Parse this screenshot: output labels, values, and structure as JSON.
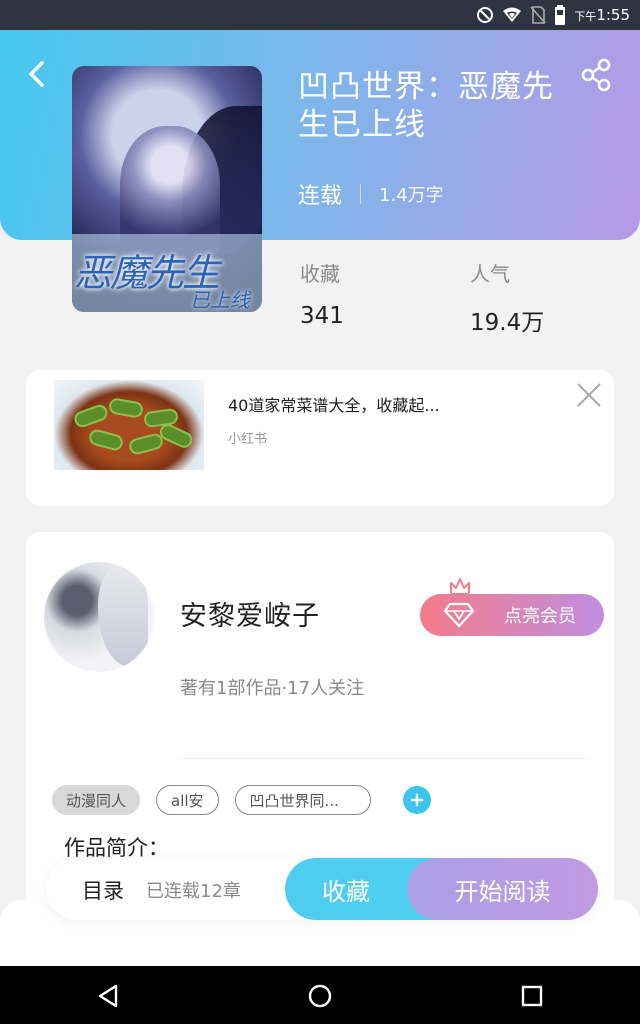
{
  "status_bar": {
    "time_prefix": "下午",
    "time": "1:55",
    "icons": [
      "dnd-icon",
      "wifi-icon",
      "no-sim-icon",
      "battery-icon"
    ]
  },
  "book": {
    "title": "凹凸世界：恶魔先生已上线",
    "serial_status": "连载",
    "word_count": "1.4万字",
    "cover_text_main": "恶魔先生",
    "cover_text_sub": "已上线",
    "stats": [
      {
        "label": "收藏",
        "value": "341"
      },
      {
        "label": "人气",
        "value": "19.4万"
      }
    ]
  },
  "ad": {
    "title": "40道家常菜谱大全，收藏起...",
    "source": "小红书"
  },
  "author": {
    "name": "安黎爱峖子",
    "meta": "著有1部作品·17人关注",
    "vip_label": "点亮会员"
  },
  "tags": [
    {
      "label": "动漫同人",
      "style": "filled"
    },
    {
      "label": "all安",
      "style": "outline"
    },
    {
      "label": "凹凸世界同...",
      "style": "outline"
    }
  ],
  "intro_label": "作品简介：",
  "action_bar": {
    "toc_label": "目录",
    "chapters": "已连载12章",
    "favorite_label": "收藏",
    "read_label": "开始阅读"
  },
  "colors": {
    "accent_blue": "#4fcdf0",
    "accent_purple": "#c19ae3",
    "vip_pink": "#f37b8a"
  }
}
